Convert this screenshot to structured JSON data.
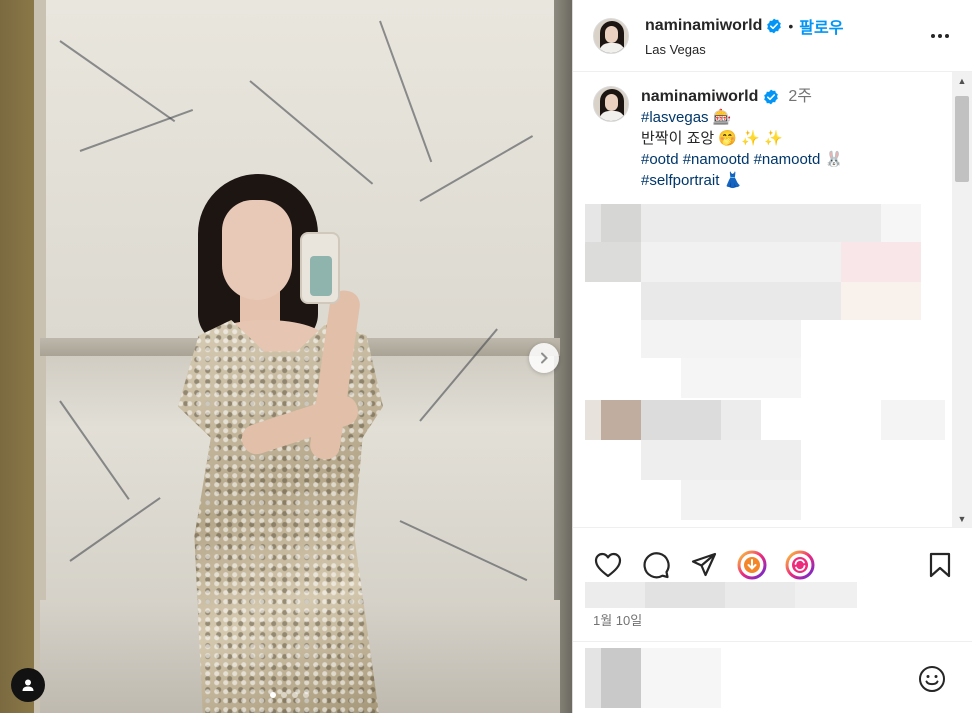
{
  "post": {
    "username": "naminamiworld",
    "follow_label": "팔로우",
    "separator": "•",
    "location": "Las Vegas",
    "time_ago": "2주",
    "date": "1월 10일"
  },
  "caption": {
    "line1": "#lasvegas 🎰",
    "line2": "반짝이 죠앙 🤭 ✨ ✨",
    "line3": "#ootd #namootd #namootd 🐰",
    "line4": "#selfportrait 👗"
  },
  "icons": {
    "verified": "verified-badge-icon",
    "more": "more-options-icon",
    "like": "heart-icon",
    "comment": "comment-bubble-icon",
    "share": "paper-plane-icon",
    "save": "bookmark-icon",
    "emoji": "smiley-icon",
    "next": "chevron-right-icon",
    "user_tag": "user-tag-icon"
  },
  "colors": {
    "accent": "#0095f6",
    "hashtag": "#00376b",
    "verified": "#0095f6",
    "muted": "#737373"
  },
  "carousel": {
    "total": 4,
    "current": 1
  }
}
